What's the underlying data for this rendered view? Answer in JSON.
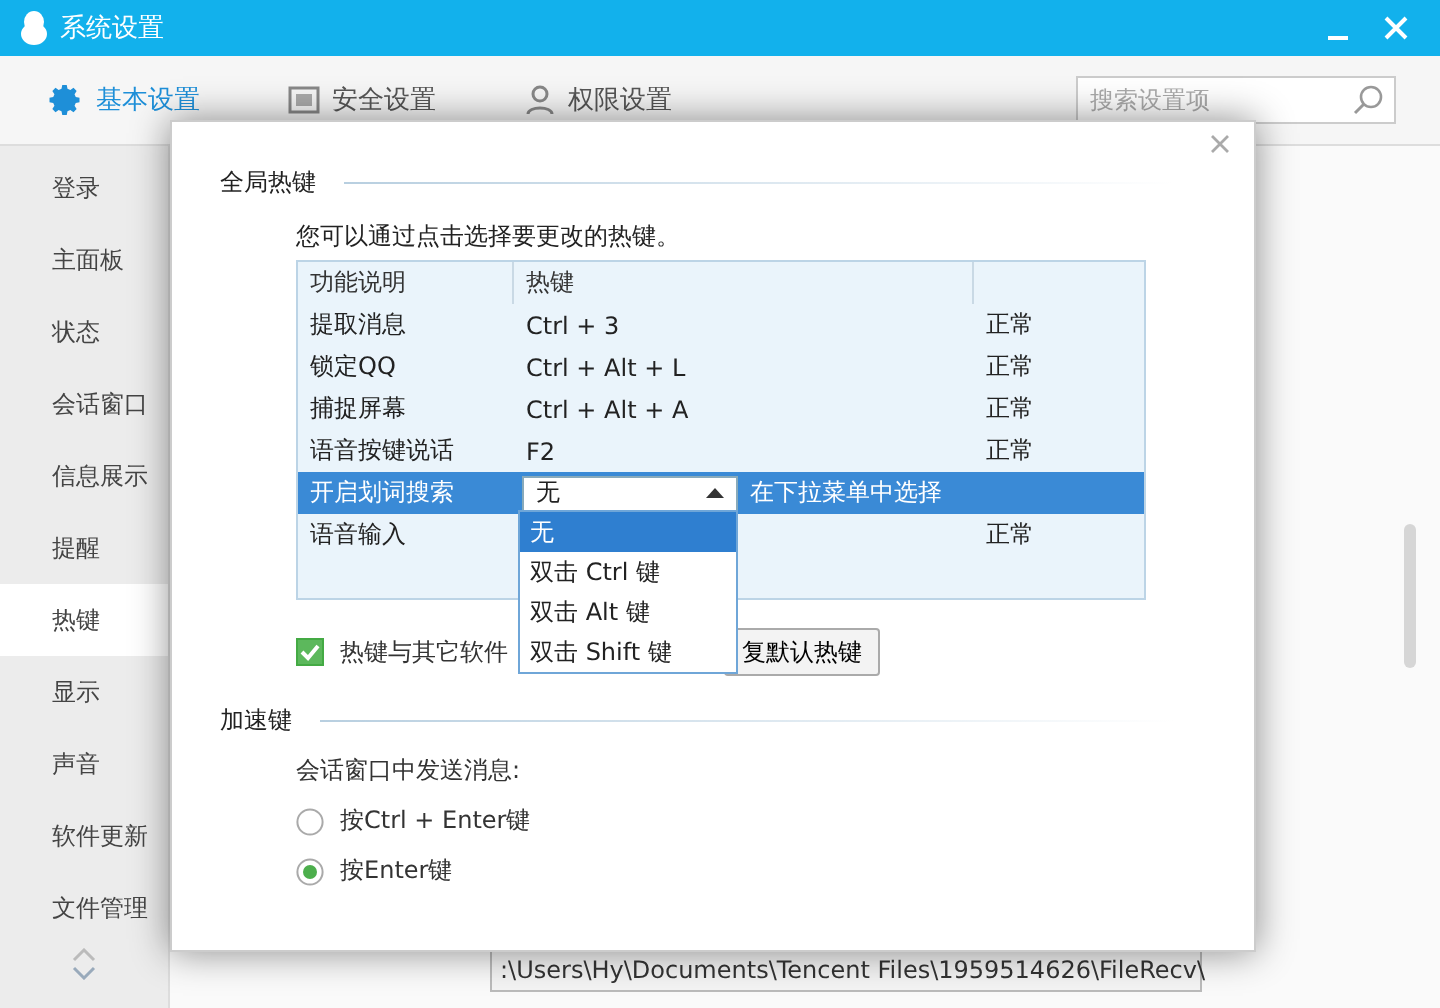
{
  "window": {
    "title": "系统设置"
  },
  "tabs": [
    {
      "label": "基本设置",
      "selected": true
    },
    {
      "label": "安全设置",
      "selected": false
    },
    {
      "label": "权限设置",
      "selected": false
    }
  ],
  "search": {
    "placeholder": "搜索设置项"
  },
  "sidebar": {
    "items": [
      {
        "label": "登录",
        "selected": false
      },
      {
        "label": "主面板",
        "selected": false
      },
      {
        "label": "状态",
        "selected": false
      },
      {
        "label": "会话窗口",
        "selected": false
      },
      {
        "label": "信息展示",
        "selected": false
      },
      {
        "label": "提醒",
        "selected": false
      },
      {
        "label": "热键",
        "selected": true
      },
      {
        "label": "显示",
        "selected": false
      },
      {
        "label": "声音",
        "selected": false
      },
      {
        "label": "软件更新",
        "selected": false
      },
      {
        "label": "文件管理",
        "selected": false
      }
    ]
  },
  "path_field": {
    "value": ":\\Users\\Hy\\Documents\\Tencent Files\\1959514626\\FileRecv\\"
  },
  "dialog": {
    "global_section": {
      "title": "全局热键",
      "hint": "您可以通过点击选择要更改的热键。",
      "table": {
        "columns": [
          "功能说明",
          "热键"
        ],
        "rows": [
          {
            "kind": "text",
            "name": "提取消息",
            "key": "Ctrl + 3",
            "status": "正常",
            "selected": false
          },
          {
            "kind": "text",
            "name": "锁定QQ",
            "key": "Ctrl + Alt + L",
            "status": "正常",
            "selected": false
          },
          {
            "kind": "text",
            "name": "捕捉屏幕",
            "key": "Ctrl + Alt + A",
            "status": "正常",
            "selected": false
          },
          {
            "kind": "text",
            "name": "语音按键说话",
            "key": "F2",
            "status": "正常",
            "selected": false
          },
          {
            "kind": "combo",
            "name": "开启划词搜索",
            "key": "无",
            "status": "在下拉菜单中选择",
            "selected": true
          },
          {
            "kind": "text",
            "name": "语音输入",
            "status": "正常",
            "selected": false
          }
        ]
      },
      "dropdown": {
        "options": [
          {
            "label": "无",
            "selected": true
          },
          {
            "label": "双击 Ctrl 键",
            "selected": false
          },
          {
            "label": "双击 Alt 键",
            "selected": false
          },
          {
            "label": "双击 Shift 键",
            "selected": false
          }
        ]
      },
      "conflict_checkbox": {
        "label": "热键与其它软件",
        "checked": true
      },
      "restore_button": "复默认热键"
    },
    "accel_section": {
      "title": "加速键",
      "label": "会话窗口中发送消息:",
      "radios": [
        {
          "label": "按Ctrl + Enter键",
          "selected": false
        },
        {
          "label": "按Enter键",
          "selected": true
        }
      ]
    }
  }
}
